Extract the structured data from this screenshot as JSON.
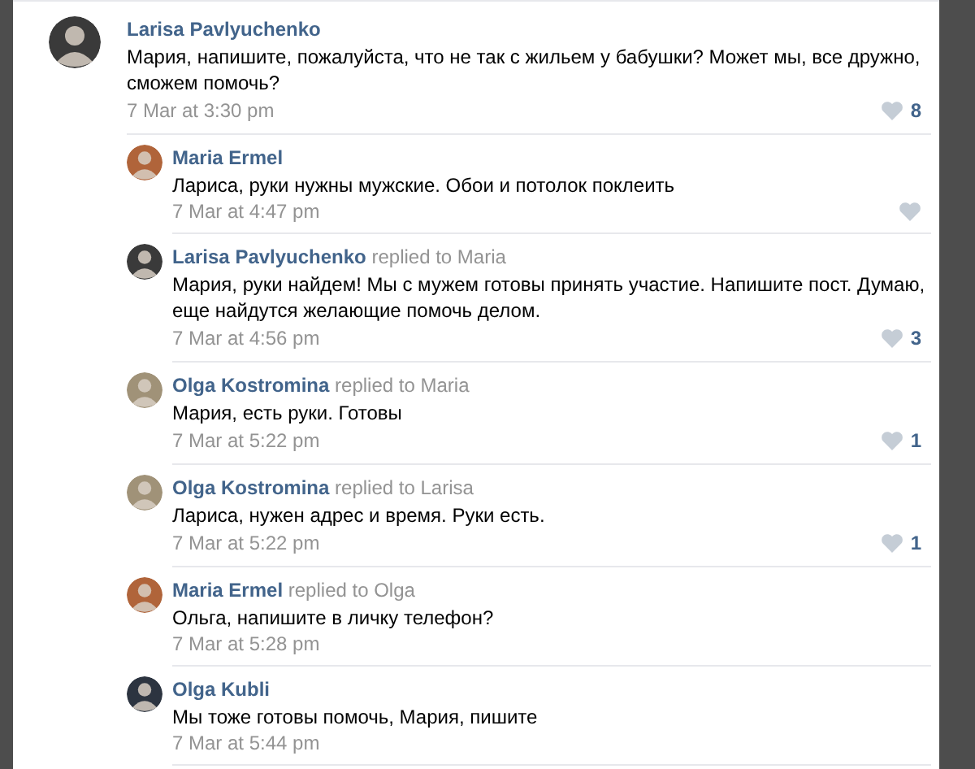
{
  "comment": {
    "author": "Larisa Pavlyuchenko",
    "color": "#3a3a3a",
    "text": "Мария, напишите, пожалуйста, что не так с жильем у бабушки? Может мы, все дружно, сможем помочь?",
    "date": "7 Mar at 3:30 pm",
    "like_icon": true,
    "likes": "8"
  },
  "replies": [
    {
      "author": "Maria Ermel",
      "color": "#b0643a",
      "text": "Лариса, руки нужны мужские. Обои и потолок поклеить",
      "date": "7 Mar at 4:47 pm",
      "like_icon": true
    },
    {
      "author": "Larisa Pavlyuchenko",
      "replied": "replied to Maria",
      "color": "#3a3a3a",
      "text": "Мария, руки найдем! Мы с мужем готовы принять участие. Напишите пост. Думаю, еще найдутся желающие помочь делом.",
      "date": "7 Mar at 4:56 pm",
      "like_icon": true,
      "likes": "3"
    },
    {
      "author": "Olga Kostromina",
      "replied": "replied to Maria",
      "color": "#a09278",
      "text": "Мария, есть руки. Готовы",
      "date": "7 Mar at 5:22 pm",
      "like_icon": true,
      "likes": "1"
    },
    {
      "author": "Olga Kostromina",
      "replied": "replied to Larisa",
      "color": "#a09278",
      "text": "Лариса, нужен адрес и время. Руки есть.",
      "date": "7 Mar at 5:22 pm",
      "like_icon": true,
      "likes": "1"
    },
    {
      "author": "Maria Ermel",
      "replied": "replied to Olga",
      "color": "#b0643a",
      "text": "Ольга, напишите в личку телефон?",
      "date": "7 Mar at 5:28 pm",
      "like_icon": false
    },
    {
      "author": "Olga Kubli",
      "color": "#2c3440",
      "text": "Мы тоже готовы помочь, Мария, пишите",
      "date": "7 Mar at 5:44 pm",
      "like_icon": false
    }
  ]
}
